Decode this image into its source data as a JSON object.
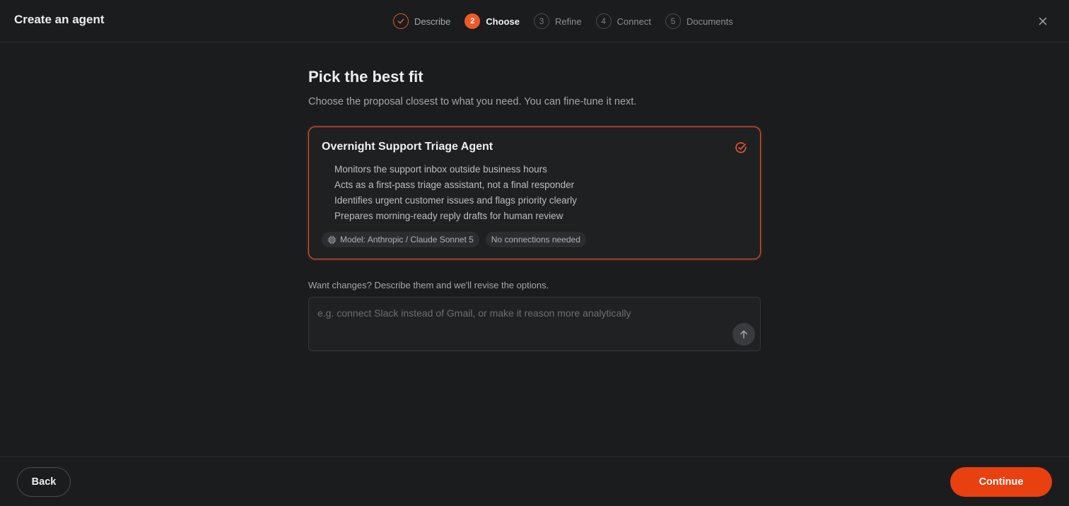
{
  "header": {
    "title": "Create an agent",
    "close_icon": "close-icon"
  },
  "stepper": {
    "steps": [
      {
        "number": "1",
        "label": "Describe",
        "state": "done"
      },
      {
        "number": "2",
        "label": "Choose",
        "state": "active"
      },
      {
        "number": "3",
        "label": "Refine",
        "state": "todo"
      },
      {
        "number": "4",
        "label": "Connect",
        "state": "todo"
      },
      {
        "number": "5",
        "label": "Documents",
        "state": "todo"
      }
    ]
  },
  "main": {
    "title": "Pick the best fit",
    "subtitle": "Choose the proposal closest to what you need. You can fine-tune it next."
  },
  "proposal": {
    "title": "Overnight Support Triage Agent",
    "selected": true,
    "bullets": [
      "Monitors the support inbox outside business hours",
      "Acts as a first-pass triage assistant, not a final responder",
      "Identifies urgent customer issues and flags priority clearly",
      "Prepares morning-ready reply drafts for human review"
    ],
    "chips": {
      "model": "Model: Anthropic / Claude Sonnet 5",
      "connections": "No connections needed"
    }
  },
  "changes": {
    "label": "Want changes? Describe them and we'll revise the options.",
    "placeholder": "e.g. connect Slack instead of Gmail, or make it reason more analytically",
    "value": ""
  },
  "footer": {
    "back_label": "Back",
    "continue_label": "Continue"
  },
  "colors": {
    "accent": "#e8582a",
    "primary_button": "#e8400f",
    "background": "#1b1c1e"
  }
}
